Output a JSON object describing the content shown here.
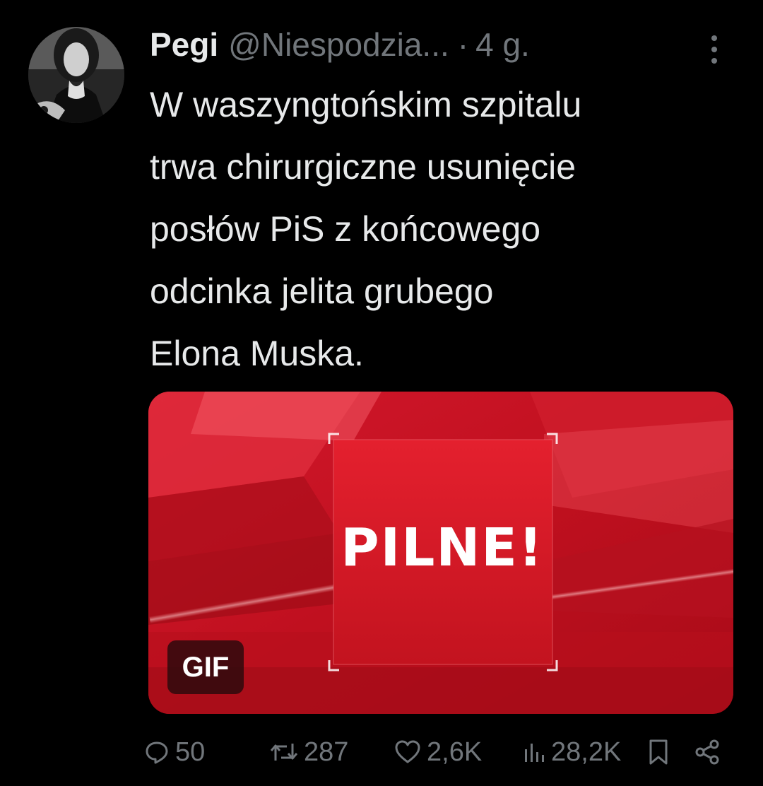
{
  "tweet": {
    "author_name": "Pegi",
    "author_handle": "@Niespodzia...",
    "separator": "·",
    "time": "4 g.",
    "text": "W waszyngtońskim szpitalu\ntrwa chirurgiczne usunięcie\nposłów PiS z końcowego\nodcinka jelita grubego\nElona Muska.",
    "media": {
      "headline": "PILNE!",
      "badge": "GIF"
    },
    "actions": {
      "replies": "50",
      "retweets": "287",
      "likes": "2,6K",
      "views": "28,2K"
    },
    "icons": {
      "more": "more-vertical-icon",
      "reply": "reply-bubble-icon",
      "retweet": "retweet-arrows-icon",
      "like": "heart-icon",
      "views": "bar-chart-icon",
      "bookmark": "bookmark-icon",
      "share": "share-icon"
    },
    "colors": {
      "background": "#000000",
      "text": "#e7e9ea",
      "muted": "#71767b",
      "media_red": "#c8102e"
    }
  }
}
